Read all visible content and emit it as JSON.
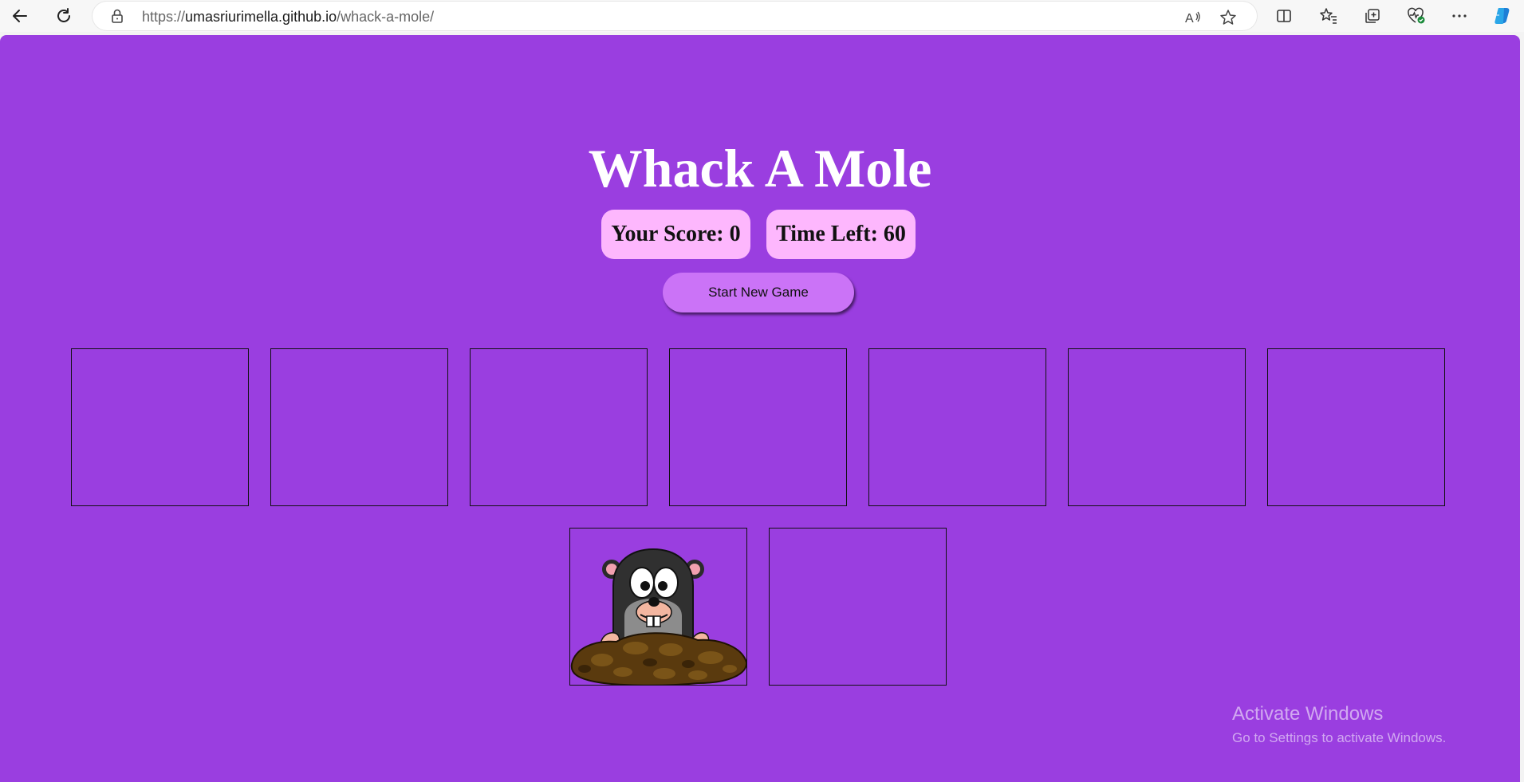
{
  "browser": {
    "url_prefix": "https://",
    "url_host": "umasriurimella.github.io",
    "url_path": "/whack-a-mole/"
  },
  "game": {
    "title": "Whack A Mole",
    "score_label": "Your Score: 0",
    "score_value": 0,
    "time_label": "Time Left: 60",
    "time_value": 60,
    "start_button": "Start New Game",
    "holes_total": 9,
    "mole_hole_index": 7
  },
  "watermark": {
    "line1": "Activate Windows",
    "line2": "Go to Settings to activate Windows."
  },
  "colors": {
    "background": "#9a3ee0",
    "stat_pill": "#fdb7fd",
    "button": "#cb73f7"
  }
}
